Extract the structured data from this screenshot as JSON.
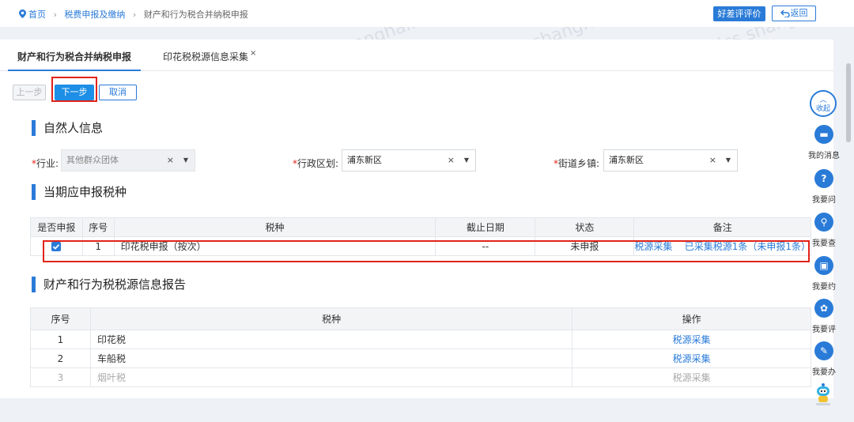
{
  "breadcrumb": {
    "home": "首页",
    "level1": "税费申报及缴纳",
    "level2": "财产和行为税合并纳税申报"
  },
  "header": {
    "review_label": "好差评评价",
    "back_label": "返回"
  },
  "tabs": [
    {
      "label": "财产和行为税合并纳税申报",
      "active": true
    },
    {
      "label": "印花税税源信息采集",
      "closable": true,
      "close": "×"
    }
  ],
  "steps": {
    "prev": "上一步",
    "next": "下一步",
    "cancel": "取消"
  },
  "sections": {
    "person": "自然人信息",
    "taxes": "当期应申报税种",
    "report": "财产和行为税税源信息报告"
  },
  "form": {
    "required_mark": "*",
    "clear": "×",
    "caret": "▼",
    "industry": {
      "label": "行业:",
      "value": "其他群众团体"
    },
    "district": {
      "label": "行政区划:",
      "value": "浦东新区"
    },
    "street": {
      "label": "街道乡镇:",
      "value": "浦东新区"
    }
  },
  "tax_table": {
    "headers": [
      "是否申报",
      "序号",
      "税种",
      "截止日期",
      "状态",
      "备注"
    ],
    "rows": [
      {
        "checked": true,
        "no": "1",
        "tax": "印花税申报（按次）",
        "deadline": "--",
        "status": "未申报",
        "note_link": "税源采集",
        "note_text": "已采集税源1条（未申报1条）"
      }
    ]
  },
  "report_table": {
    "headers": [
      "序号",
      "税种",
      "操作"
    ],
    "rows": [
      {
        "no": "1",
        "tax": "印花税",
        "action": "税源采集",
        "disabled": false
      },
      {
        "no": "2",
        "tax": "车船税",
        "action": "税源采集",
        "disabled": false
      },
      {
        "no": "3",
        "tax": "烟叶税",
        "action": "税源采集",
        "disabled": true
      }
    ]
  },
  "right_bar": {
    "collapse": "收起",
    "items": [
      "我的消息",
      "我要问",
      "我要查",
      "我要约",
      "我要评",
      "我要办"
    ]
  },
  "watermark": "dzswjcs.shanghai.china",
  "colors": {
    "accent": "#2a7bd8",
    "highlight": "#e2231a"
  }
}
